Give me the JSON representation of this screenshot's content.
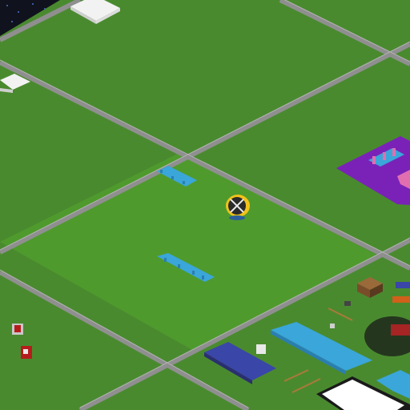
{
  "scene": {
    "view": "isometric",
    "palette": {
      "grass": "#4a8a2f",
      "grass_dark": "#3f7a27",
      "grass_selected": "#4f9a2d",
      "road": "#9a9a9a",
      "road_edge": "#7d7d7d",
      "void": "#10131d",
      "purple_zone": "#7a22b8",
      "pink": "#e16fb0",
      "blue": "#3aa6d9",
      "navy": "#3a46a8",
      "white_block": "#f2f2f2",
      "brown": "#7a4d2a",
      "red": "#b51d1d",
      "yellow": "#f2c21a"
    },
    "icons": {
      "selection_marker": "crosshair-target-icon"
    }
  }
}
